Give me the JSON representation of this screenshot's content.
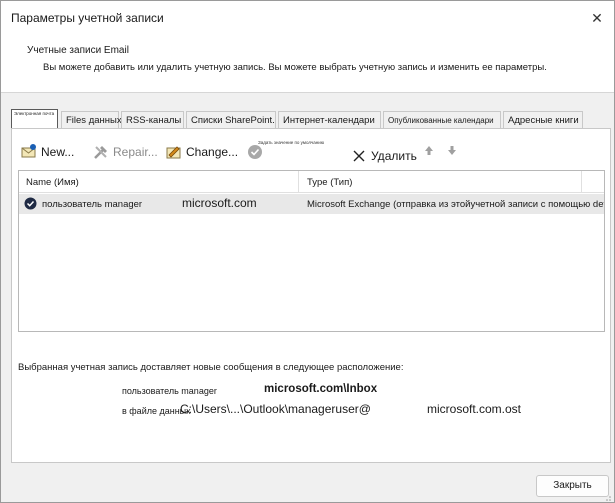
{
  "window": {
    "title": "Параметры учетной записи",
    "close_glyph": "✕"
  },
  "header": {
    "title": "Учетные записи Email",
    "description": "Вы можете добавить или удалить учетную запись. Вы можете выбрать учетную запись и изменить ее параметры."
  },
  "tabs": [
    {
      "label": "Электронная почта",
      "active": true
    },
    {
      "label": "Files данных"
    },
    {
      "label": "RSS-каналы"
    },
    {
      "label": "Списки SharePoint."
    },
    {
      "label": "Интернет-календари"
    },
    {
      "label": "Опубликованные календари"
    },
    {
      "label": "Адресные книги"
    }
  ],
  "toolbar": {
    "new_label": "New...",
    "repair_label": "Repair...",
    "change_label": "Change...",
    "set_default_label": "Задать значение по умолчанию",
    "remove_label": "Удалить"
  },
  "list": {
    "columns": {
      "name": "Name (Имя)",
      "type": "Type (Тип)"
    },
    "rows": [
      {
        "name": "пользователь manager",
        "domain": "microsoft.com",
        "type": "Microsoft Exchange (отправка из этойучетной записи с помощью def..."
      }
    ]
  },
  "delivery": {
    "info": "Выбранная учетная запись доставляет новые сообщения в следующее расположение:",
    "user": "пользователь manager",
    "inbox": "microsoft.com\\Inbox",
    "file_label": "в файле данных",
    "path": "C:\\Users\\...\\Outlook\\manageruser@",
    "ost": "microsoft.com.ost"
  },
  "footer": {
    "close_label": "Закрыть"
  },
  "colors": {
    "accent": "#1a5fb4",
    "selected_row": "#e8e8e8"
  }
}
